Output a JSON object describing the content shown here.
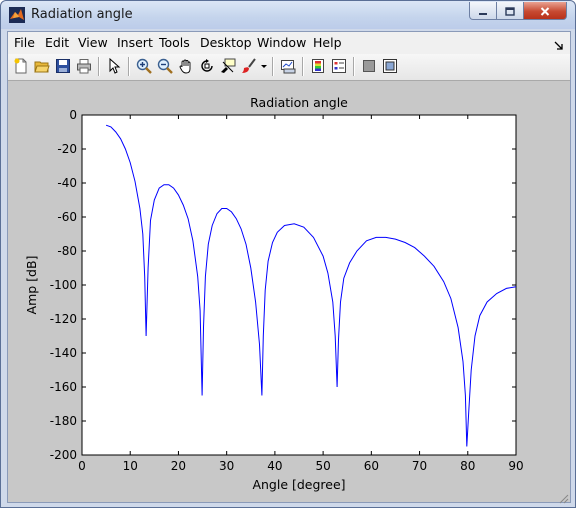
{
  "window": {
    "title": "Radiation angle",
    "accent_color": "#c4d4ec"
  },
  "menu": {
    "items": [
      {
        "label": "File"
      },
      {
        "label": "Edit"
      },
      {
        "label": "View"
      },
      {
        "label": "Insert"
      },
      {
        "label": "Tools"
      },
      {
        "label": "Desktop"
      },
      {
        "label": "Window"
      },
      {
        "label": "Help"
      }
    ]
  },
  "toolbar": {
    "buttons": [
      "new-figure-icon",
      "open-file-icon",
      "save-icon",
      "print-icon",
      "edit-plot-arrow-icon",
      "zoom-in-icon",
      "zoom-out-icon",
      "pan-hand-icon",
      "rotate-3d-icon",
      "data-cursor-icon",
      "brush-icon",
      "brush-dropdown-icon",
      "link-plot-icon",
      "insert-colorbar-icon",
      "insert-legend-icon",
      "hide-plot-tools-icon",
      "show-plot-tools-icon"
    ]
  },
  "chart_data": {
    "type": "line",
    "title": "Radiation angle",
    "xlabel": "Angle [degree]",
    "ylabel": "Amp [dB]",
    "xlim": [
      0,
      90
    ],
    "ylim": [
      -200,
      0
    ],
    "xticks": [
      "0",
      "10",
      "20",
      "30",
      "40",
      "50",
      "60",
      "70",
      "80",
      "90"
    ],
    "yticks": [
      "0",
      "-20",
      "-40",
      "-60",
      "-80",
      "-100",
      "-120",
      "-140",
      "-160",
      "-180",
      "-200"
    ],
    "grid": false,
    "line_color": "#0000ff",
    "series": [
      {
        "x": [
          5,
          6,
          7,
          8,
          9,
          10,
          11,
          12,
          12.6,
          13.0,
          13.3,
          13.7,
          14.2,
          15,
          16,
          17,
          18,
          19,
          20,
          21,
          22,
          23,
          24,
          24.5,
          24.9,
          25.2,
          25.6,
          26.2,
          27,
          28,
          29,
          30,
          31,
          32,
          33,
          34,
          35,
          36,
          36.8,
          37.3,
          37.6,
          38.0,
          38.6,
          39.5,
          40.5,
          42,
          44,
          46,
          48,
          50,
          51,
          52,
          52.5,
          52.9,
          53.2,
          53.6,
          54.3,
          55.5,
          57,
          59,
          61,
          63,
          65,
          67,
          69,
          71,
          73,
          75,
          76.5,
          78,
          79,
          79.5,
          79.8,
          80.2,
          80.7,
          81.5,
          82.5,
          84,
          86,
          88,
          90
        ],
        "y": [
          -6,
          -7,
          -10,
          -14,
          -20,
          -28,
          -39,
          -55,
          -70,
          -95,
          -130,
          -90,
          -62,
          -50,
          -43,
          -41,
          -41,
          -43,
          -47,
          -53,
          -61,
          -74,
          -95,
          -115,
          -165,
          -125,
          -95,
          -76,
          -65,
          -58,
          -55,
          -55,
          -57,
          -61,
          -67,
          -76,
          -90,
          -110,
          -135,
          -165,
          -130,
          -103,
          -86,
          -75,
          -69,
          -65,
          -64,
          -66,
          -72,
          -83,
          -93,
          -110,
          -130,
          -160,
          -132,
          -110,
          -96,
          -87,
          -80,
          -74,
          -72,
          -72,
          -73,
          -75,
          -78,
          -83,
          -89,
          -98,
          -108,
          -125,
          -145,
          -165,
          -195,
          -175,
          -150,
          -130,
          -118,
          -110,
          -105,
          -102,
          -101
        ]
      }
    ]
  }
}
